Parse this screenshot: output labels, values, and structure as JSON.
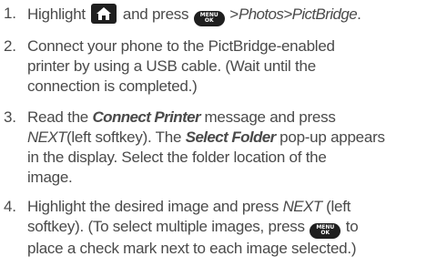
{
  "steps": [
    {
      "number": "1.",
      "parts": {
        "a": "Highlight",
        "b": "and press",
        "c": ">",
        "d": "Photos",
        "e": ">",
        "f": "PictBridge",
        "g": "."
      }
    },
    {
      "number": "2.",
      "lines": [
        "Connect your phone to the PictBridge-enabled",
        "printer by using a USB cable. (Wait until the",
        "connection is completed.)"
      ]
    },
    {
      "number": "3.",
      "parts": {
        "a": "Read the",
        "b": "Connect Printer",
        "c": "message and press",
        "d": "NEXT",
        "e": "(left softkey). The",
        "f": "Select Folder",
        "g": "pop-up appears",
        "h": "in the display. Select the folder location of the",
        "i": "image."
      }
    },
    {
      "number": "4.",
      "parts": {
        "a": "Highlight the desired image and press",
        "b": "NEXT",
        "c": "(left",
        "d": "softkey). (To select multiple images, press",
        "e": "to",
        "f": "place a check mark next to each image selected.)"
      }
    }
  ],
  "keys": {
    "menu_top": "MENU",
    "menu_bottom": "OK"
  },
  "icons": {
    "home": "home-icon",
    "menu_ok": "menu-ok-key-icon"
  },
  "colors": {
    "text": "#4a4a4a",
    "key_bg": "#1f1f1f"
  }
}
